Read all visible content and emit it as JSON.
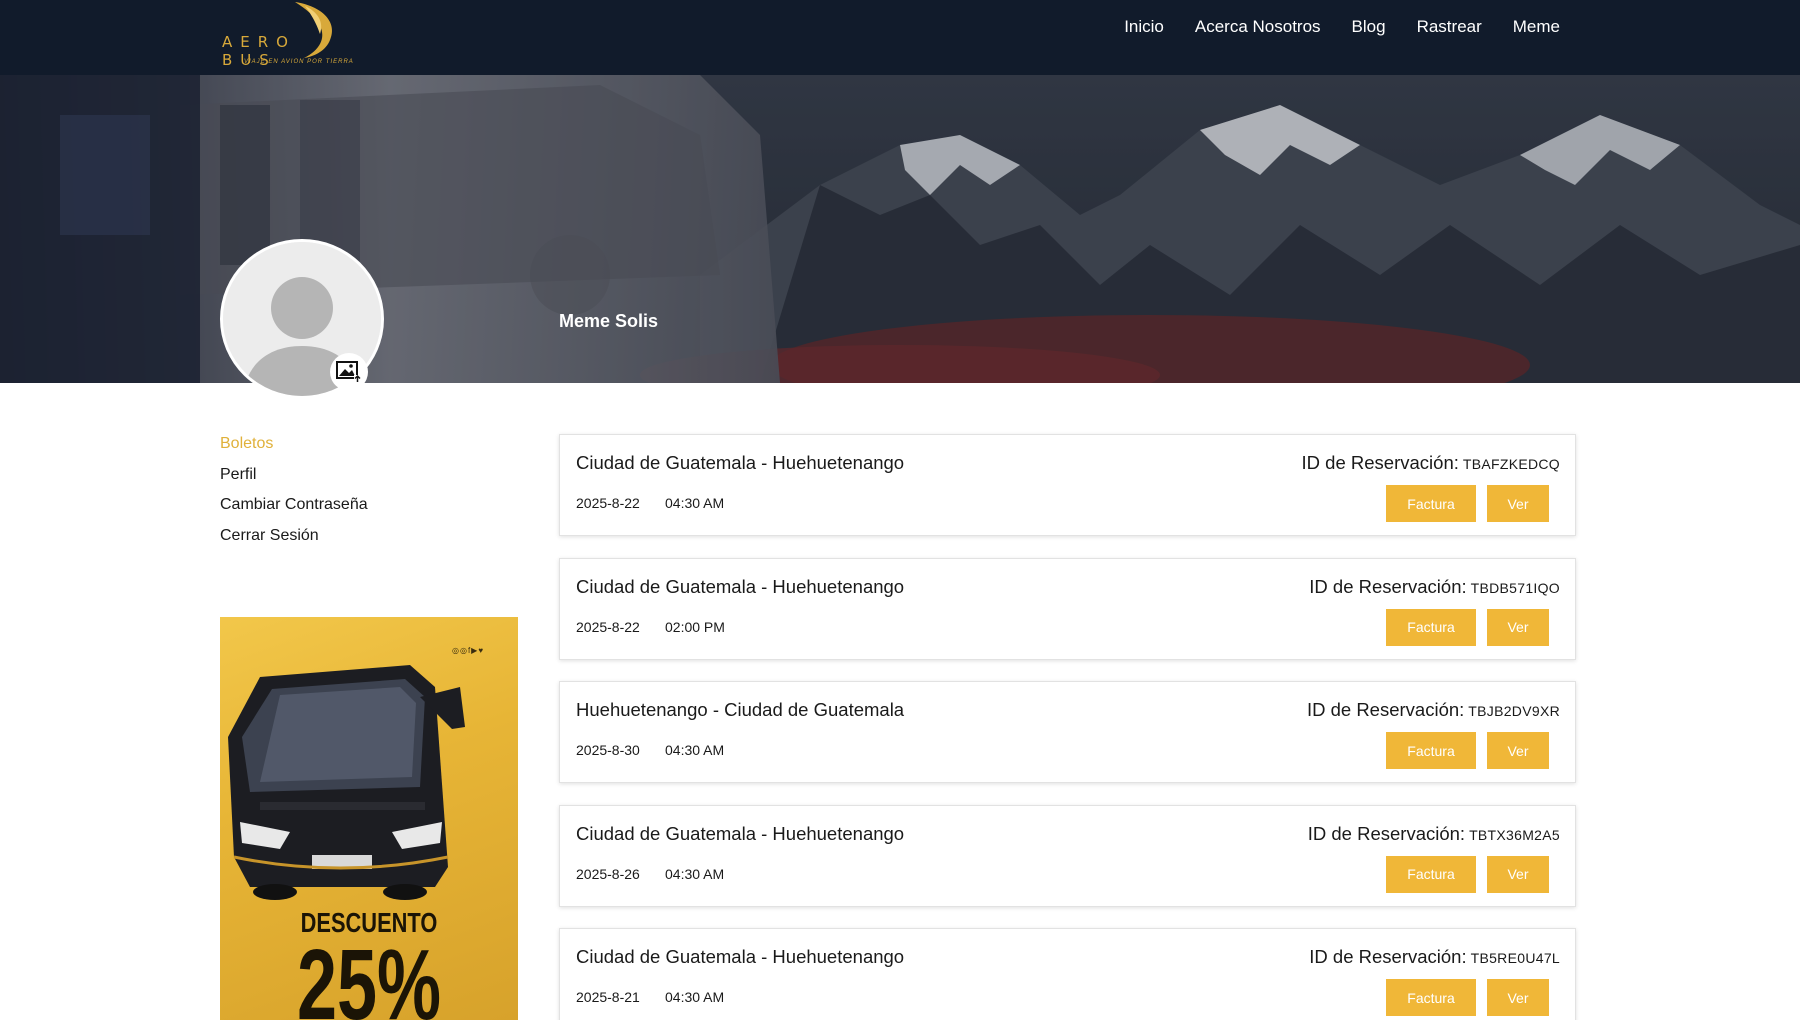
{
  "logo": {
    "word_left": "AERO",
    "word_right": "BUS",
    "tagline": "VIAJE EN AVION POR TIERRA"
  },
  "nav": {
    "items": [
      "Inicio",
      "Acerca Nosotros",
      "Blog",
      "Rastrear",
      "Meme"
    ]
  },
  "profile": {
    "name": "Meme Solis"
  },
  "sidebar": {
    "items": [
      "Boletos",
      "Perfil",
      "Cambiar Contraseña",
      "Cerrar Sesión"
    ],
    "active": "Boletos"
  },
  "promo": {
    "social": "◎◎f▶♥",
    "title": "DESCUENTO",
    "big": "25%"
  },
  "ticket_labels": {
    "id_label": "ID de Reservación:",
    "invoice_button": "Factura",
    "view_button": "Ver"
  },
  "tickets": [
    {
      "route": "Ciudad de Guatemala - Huehuetenango",
      "date": "2025-8-22",
      "time": "04:30 AM",
      "code": "TBAFZKEDCQ"
    },
    {
      "route": "Ciudad de Guatemala - Huehuetenango",
      "date": "2025-8-22",
      "time": "02:00 PM",
      "code": "TBDB571IQO"
    },
    {
      "route": "Huehuetenango - Ciudad de Guatemala",
      "date": "2025-8-30",
      "time": "04:30 AM",
      "code": "TBJB2DV9XR"
    },
    {
      "route": "Ciudad de Guatemala - Huehuetenango",
      "date": "2025-8-26",
      "time": "04:30 AM",
      "code": "TBTX36M2A5"
    },
    {
      "route": "Ciudad de Guatemala - Huehuetenango",
      "date": "2025-8-21",
      "time": "04:30 AM",
      "code": "TB5RE0U47L"
    }
  ],
  "colors": {
    "navbar": "#111b2b",
    "accent": "#f0b738",
    "active_link": "#e0b13a",
    "logo_gold": "#d8a93a"
  },
  "icons": {
    "avatar_upload": "image-upload-icon",
    "avatar": "user-silhouette-icon"
  }
}
